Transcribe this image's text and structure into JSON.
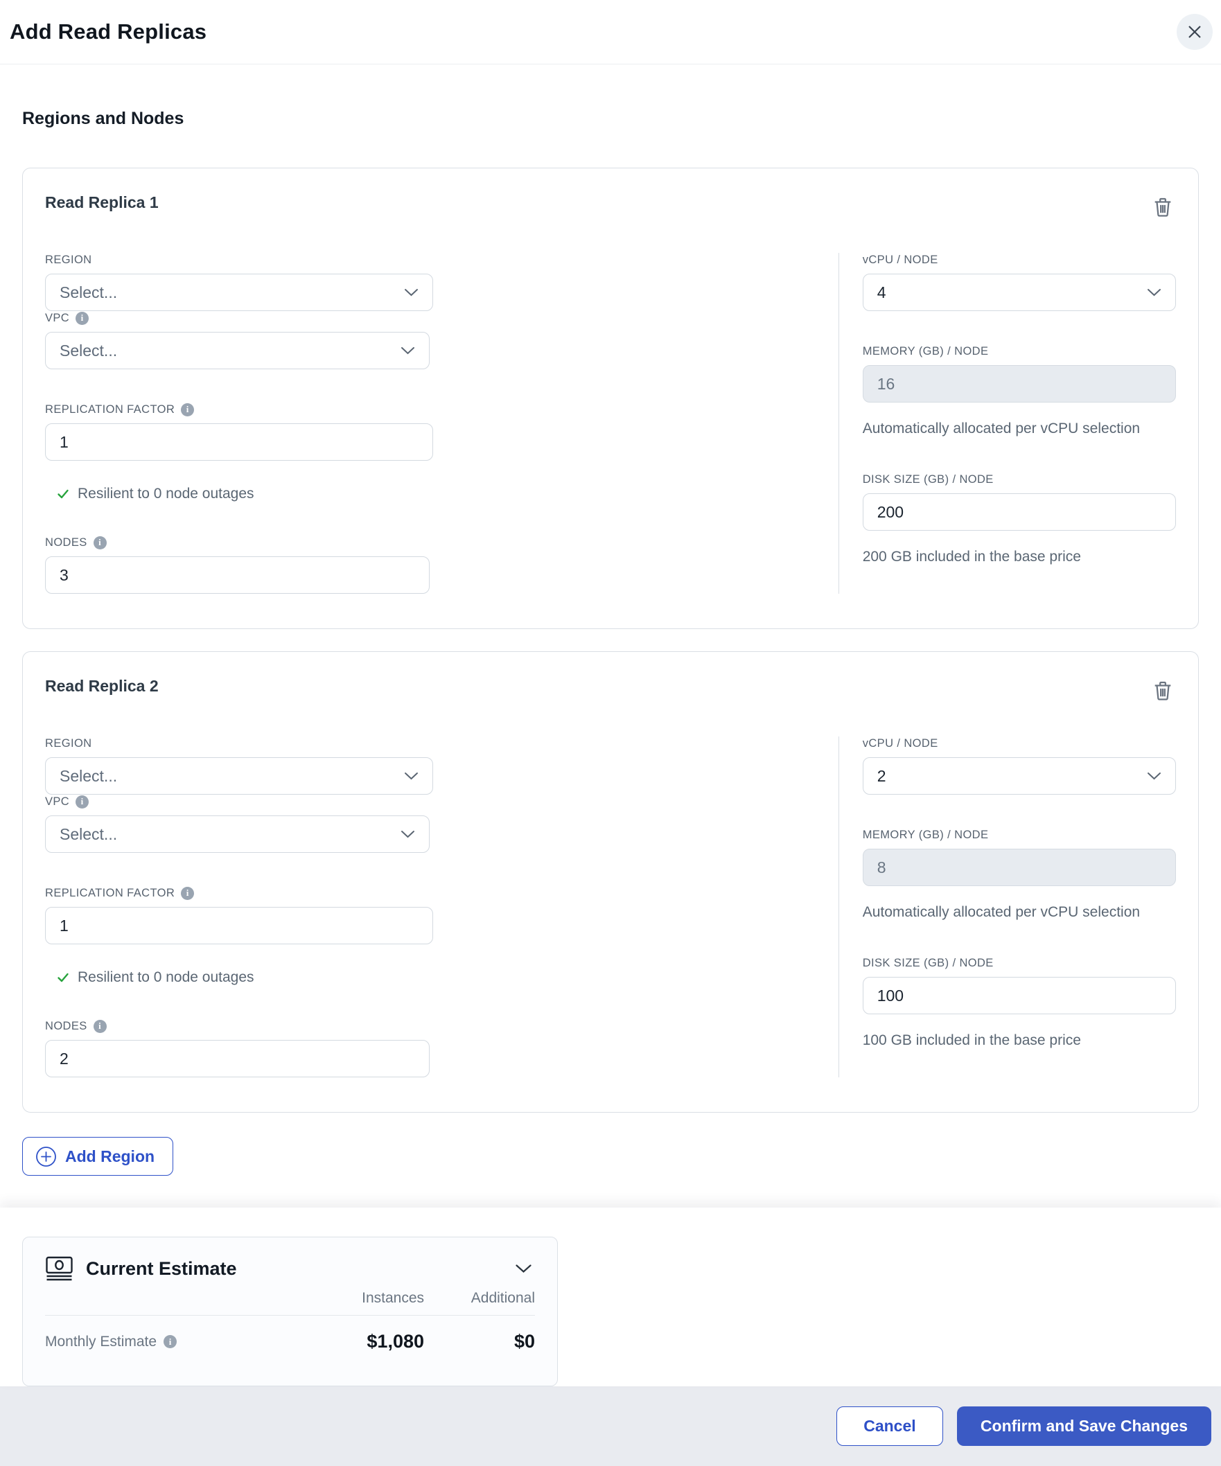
{
  "header": {
    "title": "Add Read Replicas"
  },
  "section_title": "Regions and Nodes",
  "labels": {
    "region": "REGION",
    "vpc": "VPC",
    "replication_factor": "REPLICATION FACTOR",
    "nodes": "NODES",
    "vcpu": "vCPU / NODE",
    "memory": "MEMORY (GB) / NODE",
    "disk": "DISK SIZE (GB) / NODE",
    "memory_helper": "Automatically allocated per vCPU selection",
    "info_glyph": "i"
  },
  "replicas": [
    {
      "title": "Read Replica 1",
      "region_value": "Select...",
      "vpc_value": "Select...",
      "vcpu_value": "4",
      "replication_factor": "1",
      "nodes": "3",
      "memory": "16",
      "disk": "200",
      "resilience_text": "Resilient to 0 node outages",
      "disk_helper": "200 GB included in the base price"
    },
    {
      "title": "Read Replica 2",
      "region_value": "Select...",
      "vpc_value": "Select...",
      "vcpu_value": "2",
      "replication_factor": "1",
      "nodes": "2",
      "memory": "8",
      "disk": "100",
      "resilience_text": "Resilient to 0 node outages",
      "disk_helper": "100 GB included in the base price"
    }
  ],
  "add_region_label": "Add Region",
  "estimate": {
    "title": "Current Estimate",
    "col_instances": "Instances",
    "col_additional": "Additional",
    "row_label": "Monthly Estimate",
    "instances_value": "$1,080",
    "additional_value": "$0"
  },
  "footer": {
    "cancel": "Cancel",
    "confirm": "Confirm and Save Changes"
  },
  "colors": {
    "accent_blue": "#2e51c8",
    "confirm_blue": "#3b5ac4",
    "success_green": "#27a33c",
    "label_gray": "#57626f",
    "footer_bg": "#e9ebf0"
  }
}
